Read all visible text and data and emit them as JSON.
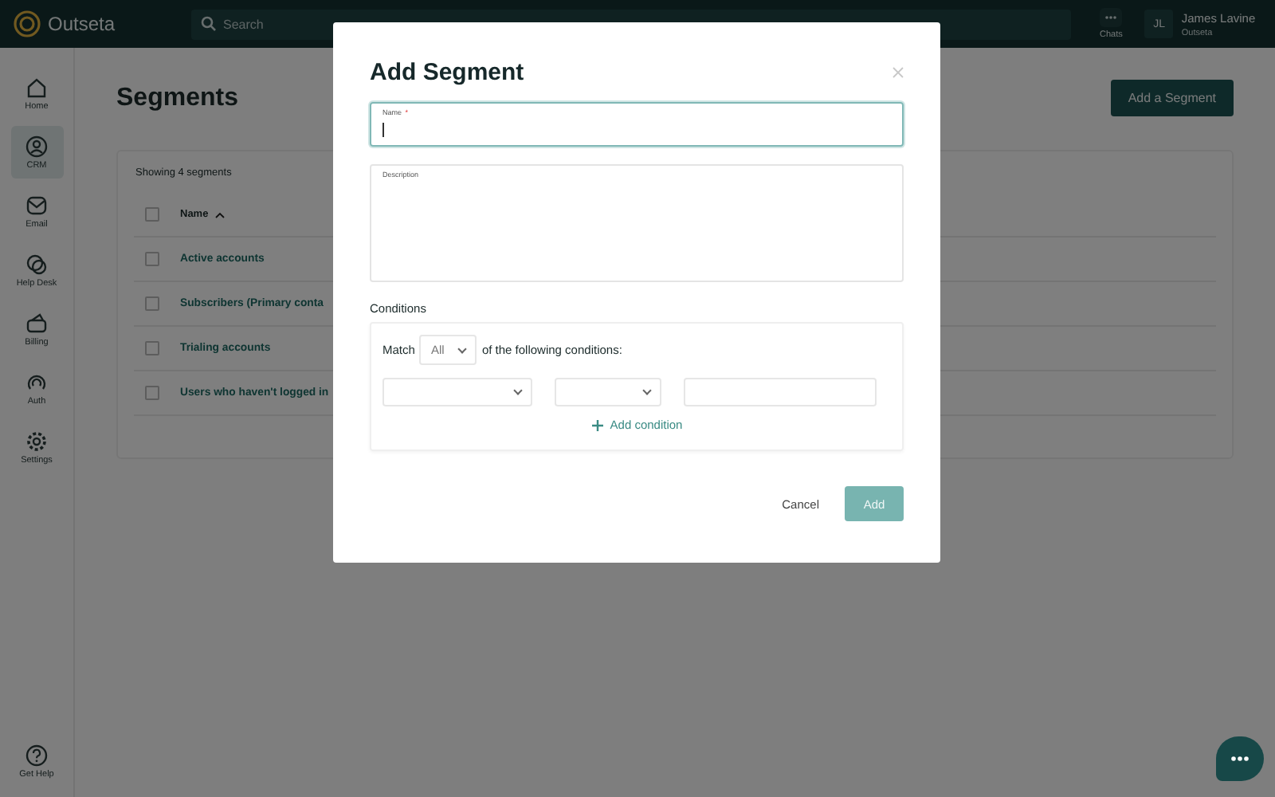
{
  "topbar": {
    "logo": "Outseta",
    "search": {
      "placeholder": "Search"
    },
    "chats_label": "Chats",
    "user": {
      "initials": "JL",
      "name": "James Lavine",
      "org": "Outseta"
    }
  },
  "sidebar": {
    "items": [
      {
        "label": "Home",
        "selected": false
      },
      {
        "label": "CRM",
        "selected": true
      },
      {
        "label": "Email",
        "selected": false
      },
      {
        "label": "Help Desk",
        "selected": false
      },
      {
        "label": "Billing",
        "selected": false
      },
      {
        "label": "Auth",
        "selected": false
      },
      {
        "label": "Settings",
        "selected": false
      }
    ],
    "help": "Get Help"
  },
  "page": {
    "title": "Segments",
    "add_button": "Add a Segment",
    "count": "Showing 4 segments",
    "column": "Name",
    "all_checked": false,
    "rows": [
      {
        "name": "Active accounts",
        "checked": false
      },
      {
        "name": "Subscribers (Primary conta",
        "checked": false
      },
      {
        "name": "Trialing accounts",
        "checked": false
      },
      {
        "name": "Users who haven't logged in",
        "checked": false
      }
    ]
  },
  "modal": {
    "title": "Add Segment",
    "name_field": {
      "label": "Name",
      "required_mark": "*"
    },
    "description_field": {
      "label": "Description"
    },
    "conditions_label": "Conditions",
    "match_prefix": "Match",
    "match_value": "All",
    "match_suffix": "of the following conditions:",
    "add_condition": "Add condition",
    "cancel": "Cancel",
    "submit": {
      "label": "Add",
      "disabled": true
    }
  }
}
